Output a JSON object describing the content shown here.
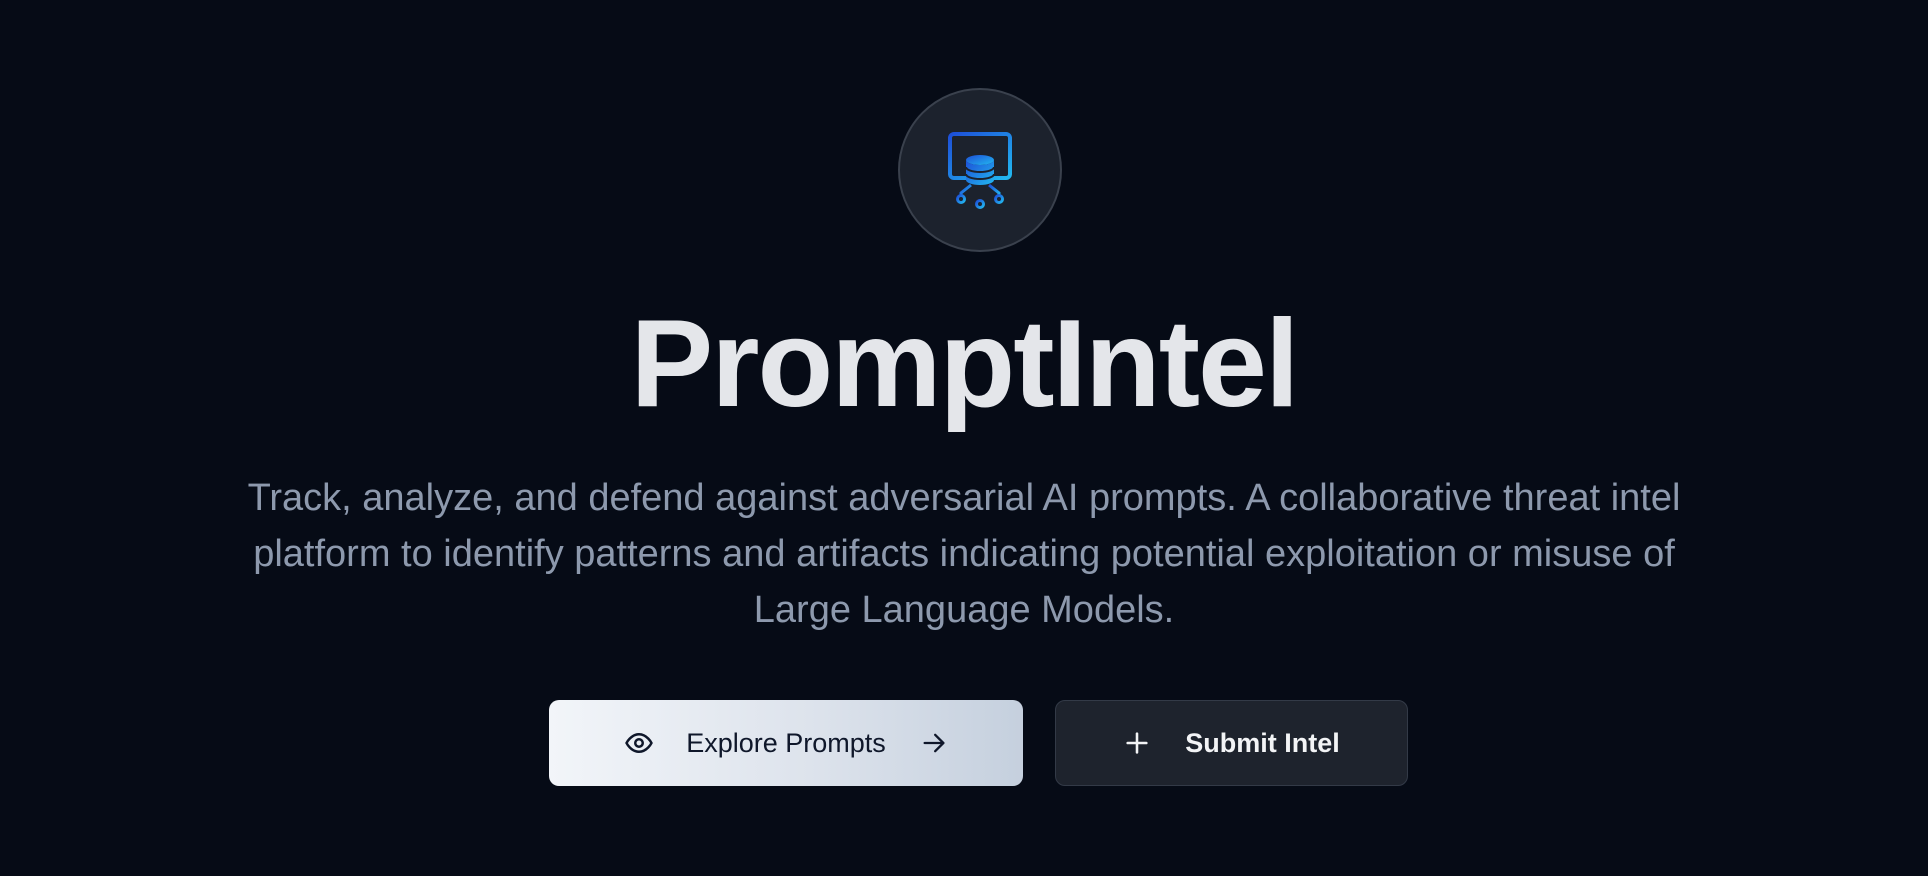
{
  "hero": {
    "logo_icon": "database-document-circuit-icon",
    "title": "PromptIntel",
    "subtitle": "Track, analyze, and defend against adversarial AI prompts. A collaborative threat intel platform to identify patterns and artifacts indicating potential exploitation or misuse of Large Language Models."
  },
  "actions": {
    "explore_label": "Explore Prompts",
    "explore_icon": "eye-icon",
    "explore_trailing_icon": "arrow-right-icon",
    "submit_label": "Submit Intel",
    "submit_icon": "plus-icon"
  },
  "colors": {
    "background": "#060b16",
    "title": "#e4e6ea",
    "subtitle": "#8d99ad",
    "logo_gradient_start": "#1d4fd8",
    "logo_gradient_end": "#22b8f0"
  }
}
